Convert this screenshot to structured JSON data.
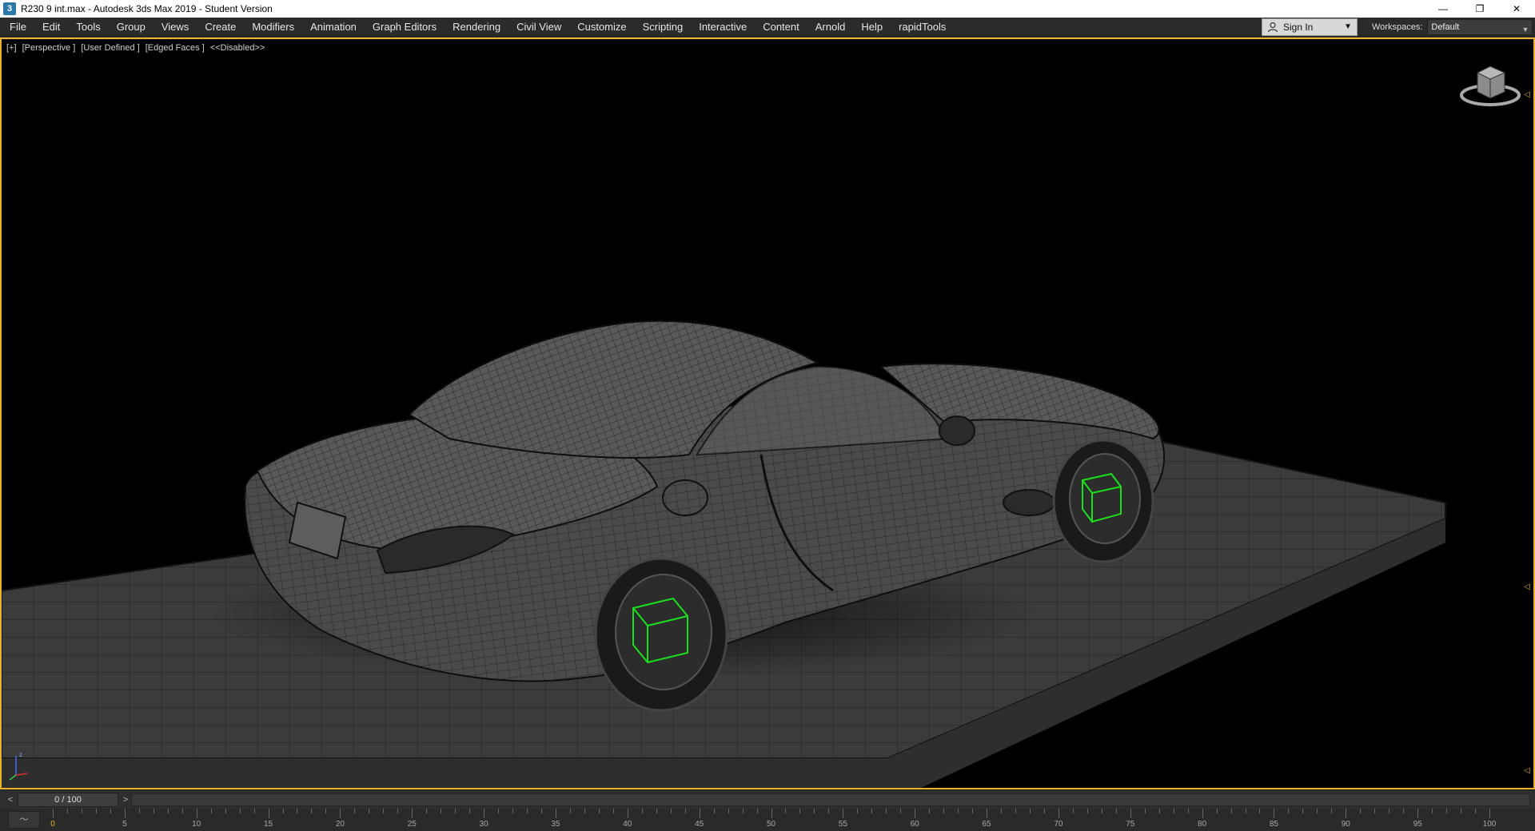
{
  "window": {
    "title": "R230 9 int.max - Autodesk 3ds Max 2019 - Student Version",
    "app_icon_glyph": "3",
    "controls": {
      "minimize": "—",
      "restore": "❐",
      "close": "✕"
    }
  },
  "menu": {
    "items": [
      "File",
      "Edit",
      "Tools",
      "Group",
      "Views",
      "Create",
      "Modifiers",
      "Animation",
      "Graph Editors",
      "Rendering",
      "Civil View",
      "Customize",
      "Scripting",
      "Interactive",
      "Content",
      "Arnold",
      "Help",
      "rapidTools"
    ],
    "sign_in_label": "Sign In",
    "workspaces_label": "Workspaces:",
    "workspaces_value": "Default"
  },
  "viewport": {
    "label_parts": [
      "[+]",
      "[Perspective ]",
      "[User Defined ]",
      "[Edged Faces ]",
      "<<Disabled>>"
    ],
    "accent_color": "#e8b22a",
    "wheel_gizmo_color": "#19e01a",
    "axis_labels": {
      "z": "z",
      "x": "x",
      "y": "y"
    }
  },
  "timeline": {
    "frame_display": "0 / 100",
    "prev_label": "<",
    "next_label": ">",
    "ticks": [
      "0",
      "5",
      "10",
      "15",
      "20",
      "25",
      "30",
      "35",
      "40",
      "45",
      "50",
      "55",
      "60",
      "65",
      "70",
      "75",
      "80",
      "85",
      "90",
      "95",
      "100"
    ]
  }
}
